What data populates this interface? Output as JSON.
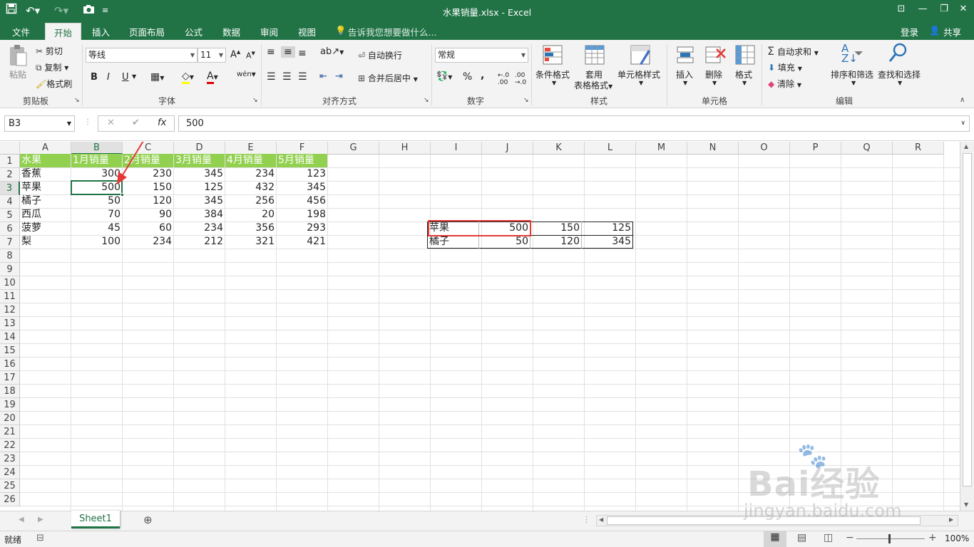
{
  "window": {
    "title": "水果销量.xlsx - Excel"
  },
  "ribbon_tabs": {
    "file": "文件",
    "home": "开始",
    "insert": "插入",
    "page_layout": "页面布局",
    "formulas": "公式",
    "data": "数据",
    "review": "审阅",
    "view": "视图",
    "tell_me": "告诉我您想要做什么...",
    "login": "登录",
    "share": "共享"
  },
  "clipboard": {
    "paste": "粘贴",
    "cut": "剪切",
    "copy": "复制",
    "format_painter": "格式刷",
    "group": "剪贴板"
  },
  "font": {
    "name": "等线",
    "size": "11",
    "bold": "B",
    "italic": "I",
    "underline": "U",
    "group": "字体",
    "grow": "A",
    "shrink": "A",
    "font_color": "A",
    "wen": "wén"
  },
  "alignment": {
    "wrap": "自动换行",
    "merge": "合并后居中",
    "group": "对齐方式"
  },
  "number": {
    "format": "常规",
    "percent": "%",
    "comma": ",",
    "group": "数字"
  },
  "styles": {
    "conditional": "条件格式",
    "table_format_1": "套用",
    "table_format_2": "表格格式",
    "cell_styles": "单元格样式",
    "group": "样式"
  },
  "cells": {
    "insert": "插入",
    "delete": "删除",
    "format": "格式",
    "group": "单元格"
  },
  "editing": {
    "autosum": "自动求和",
    "fill": "填充",
    "clear": "清除",
    "sort_filter": "排序和筛选",
    "find_select": "查找和选择",
    "group": "编辑"
  },
  "formula_bar": {
    "name_box": "B3",
    "formula": "500",
    "fx": "fx",
    "cancel": "✕",
    "enter": "✔"
  },
  "columns": [
    "A",
    "B",
    "C",
    "D",
    "E",
    "F",
    "G",
    "H",
    "I",
    "J",
    "K",
    "L",
    "M",
    "N",
    "O",
    "P",
    "Q",
    "R"
  ],
  "rows": [
    "1",
    "2",
    "3",
    "4",
    "5",
    "6",
    "7",
    "8",
    "9",
    "10",
    "11",
    "12",
    "13",
    "14",
    "15",
    "16",
    "17",
    "18",
    "19",
    "20",
    "21",
    "22",
    "23",
    "24",
    "25",
    "26"
  ],
  "table": {
    "header": [
      "水果",
      "1月销量",
      "2月销量",
      "3月销量",
      "4月销量",
      "5月销量"
    ],
    "rows": [
      [
        "香蕉",
        "300",
        "230",
        "345",
        "234",
        "123"
      ],
      [
        "苹果",
        "500",
        "150",
        "125",
        "432",
        "345"
      ],
      [
        "橘子",
        "50",
        "120",
        "345",
        "256",
        "456"
      ],
      [
        "西瓜",
        "70",
        "90",
        "384",
        "20",
        "198"
      ],
      [
        "菠萝",
        "45",
        "60",
        "234",
        "356",
        "293"
      ],
      [
        "梨",
        "100",
        "234",
        "212",
        "321",
        "421"
      ]
    ]
  },
  "side_table": {
    "rows": [
      [
        "苹果",
        "500",
        "150",
        "125"
      ],
      [
        "橘子",
        "50",
        "120",
        "345"
      ]
    ]
  },
  "sheet_tabs": [
    "Sheet1"
  ],
  "status": {
    "ready": "就绪",
    "zoom": "100%"
  },
  "watermark": {
    "brand": "Bai经验",
    "url": "jingyan.baidu.com"
  },
  "colors": {
    "excel_green": "#217346",
    "header_fill": "#92d050",
    "annotation_red": "#e53935"
  }
}
